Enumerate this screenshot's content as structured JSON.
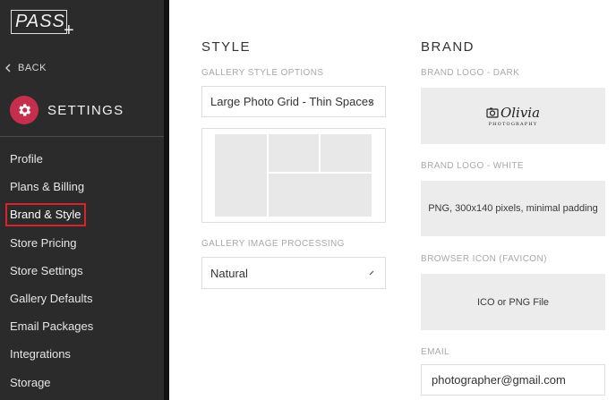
{
  "sidebar": {
    "logo": "PASS",
    "back_label": "BACK",
    "settings_label": "SETTINGS",
    "items": [
      {
        "label": "Profile"
      },
      {
        "label": "Plans & Billing"
      },
      {
        "label": "Brand & Style",
        "active": true
      },
      {
        "label": "Store Pricing"
      },
      {
        "label": "Store Settings"
      },
      {
        "label": "Gallery Defaults"
      },
      {
        "label": "Email Packages"
      },
      {
        "label": "Integrations"
      },
      {
        "label": "Storage"
      }
    ]
  },
  "style": {
    "title": "STYLE",
    "gallery_style_label": "GALLERY STYLE OPTIONS",
    "gallery_style_value": "Large Photo Grid - Thin Spaces",
    "image_processing_label": "GALLERY IMAGE PROCESSING",
    "image_processing_value": "Natural"
  },
  "brand": {
    "title": "BRAND",
    "logo_dark_label": "BRAND LOGO - DARK",
    "logo_dark_text": "Olivia",
    "logo_dark_subtext": "PHOTOGRAPHY",
    "logo_white_label": "BRAND LOGO - WHITE",
    "logo_white_hint": "PNG, 300x140 pixels, minimal padding",
    "favicon_label": "BROWSER ICON (FAVICON)",
    "favicon_hint": "ICO or PNG File",
    "email_label": "EMAIL",
    "email_value": "photographer@gmail.com"
  },
  "colors": {
    "sidebar_bg": "#2b2b2b",
    "accent": "#c62e4e",
    "active_outline": "#d8232a"
  }
}
